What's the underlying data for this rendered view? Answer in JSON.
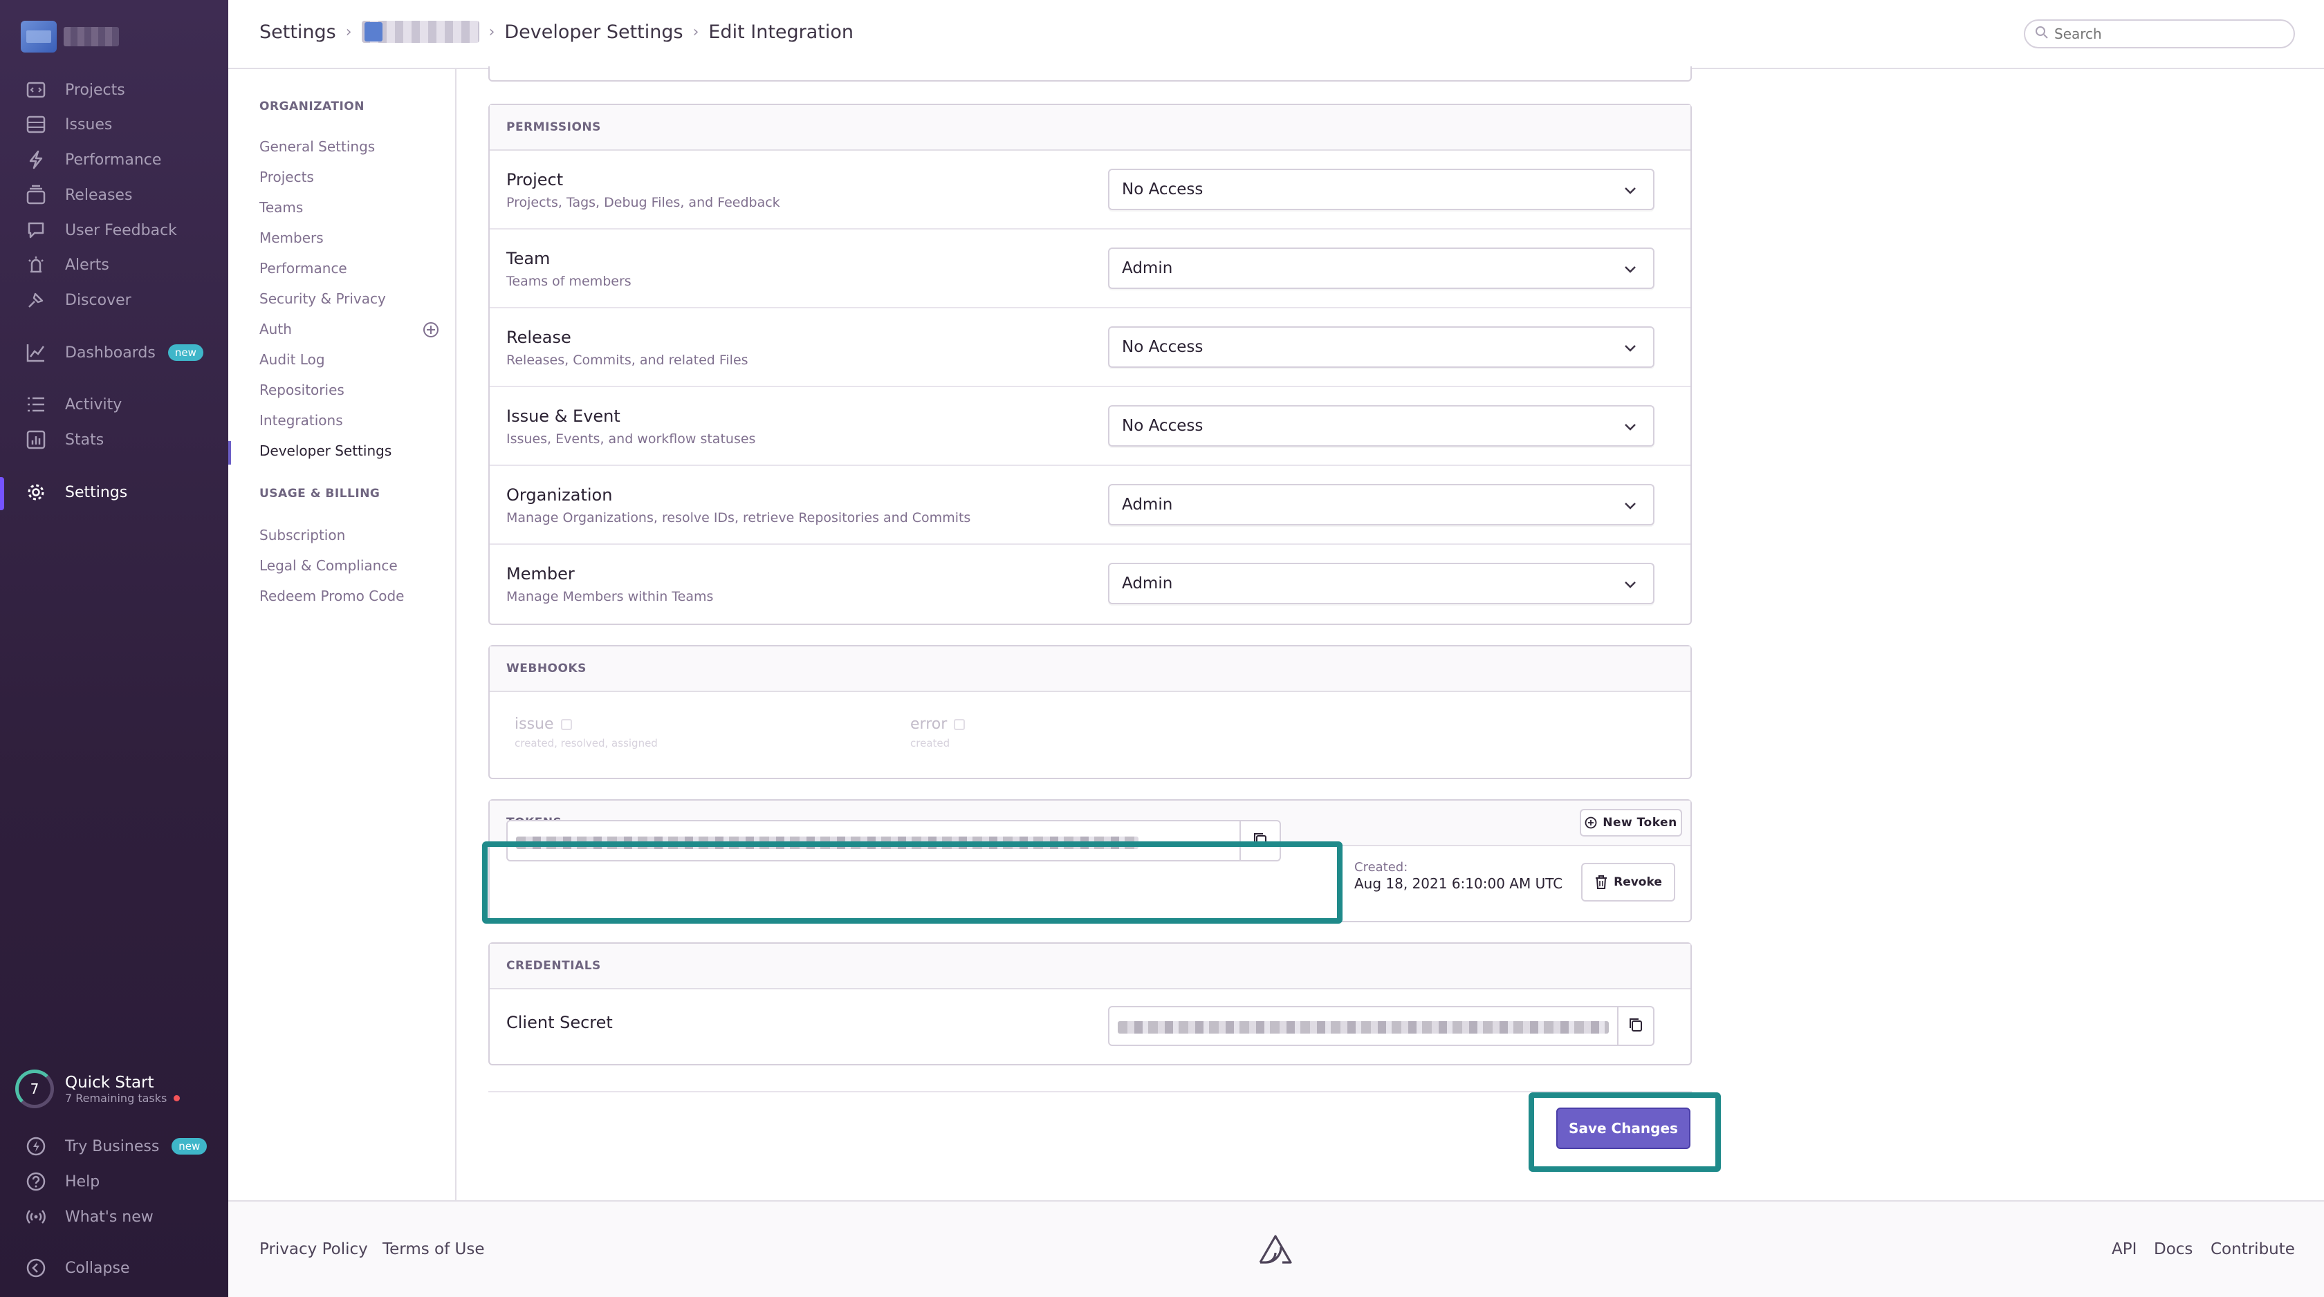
{
  "sidebar": {
    "items": [
      {
        "label": "Projects",
        "icon": "projects-icon"
      },
      {
        "label": "Issues",
        "icon": "issues-icon"
      },
      {
        "label": "Performance",
        "icon": "performance-icon"
      },
      {
        "label": "Releases",
        "icon": "releases-icon"
      },
      {
        "label": "User Feedback",
        "icon": "user-feedback-icon"
      },
      {
        "label": "Alerts",
        "icon": "alerts-icon"
      },
      {
        "label": "Discover",
        "icon": "discover-icon"
      },
      {
        "label": "Dashboards",
        "icon": "dashboards-icon",
        "badge": "new"
      },
      {
        "label": "Activity",
        "icon": "activity-icon"
      },
      {
        "label": "Stats",
        "icon": "stats-icon"
      },
      {
        "label": "Settings",
        "icon": "settings-icon",
        "active": true
      }
    ],
    "quick_start": {
      "count": "7",
      "title": "Quick Start",
      "subtitle": "7 Remaining tasks"
    },
    "bottom": [
      {
        "label": "Try Business",
        "icon": "lightning-icon",
        "badge": "new"
      },
      {
        "label": "Help",
        "icon": "help-icon"
      },
      {
        "label": "What's new",
        "icon": "broadcast-icon"
      },
      {
        "label": "Collapse",
        "icon": "collapse-icon"
      }
    ]
  },
  "header": {
    "breadcrumb": [
      "Settings",
      "Developer Settings",
      "Edit Integration"
    ],
    "search_placeholder": "Search"
  },
  "subnav": {
    "organization_heading": "ORGANIZATION",
    "organization_links": [
      "General Settings",
      "Projects",
      "Teams",
      "Members",
      "Performance",
      "Security & Privacy",
      "Auth",
      "Audit Log",
      "Repositories",
      "Integrations",
      "Developer Settings"
    ],
    "billing_heading": "USAGE & BILLING",
    "billing_links": [
      "Subscription",
      "Legal & Compliance",
      "Redeem Promo Code"
    ]
  },
  "permissions": {
    "heading": "PERMISSIONS",
    "rows": [
      {
        "title": "Project",
        "desc": "Projects, Tags, Debug Files, and Feedback",
        "value": "No Access"
      },
      {
        "title": "Team",
        "desc": "Teams of members",
        "value": "Admin"
      },
      {
        "title": "Release",
        "desc": "Releases, Commits, and related Files",
        "value": "No Access"
      },
      {
        "title": "Issue & Event",
        "desc": "Issues, Events, and workflow statuses",
        "value": "No Access"
      },
      {
        "title": "Organization",
        "desc": "Manage Organizations, resolve IDs, retrieve Repositories and Commits",
        "value": "Admin"
      },
      {
        "title": "Member",
        "desc": "Manage Members within Teams",
        "value": "Admin"
      }
    ]
  },
  "webhooks": {
    "heading": "WEBHOOKS",
    "items": [
      {
        "label": "issue",
        "sub": "created, resolved, assigned"
      },
      {
        "label": "error",
        "sub": "created"
      }
    ]
  },
  "tokens": {
    "heading": "TOKENS",
    "new_token_label": "New Token",
    "created_label": "Created:",
    "created_value": "Aug 18, 2021 6:10:00 AM UTC",
    "revoke_label": "Revoke"
  },
  "credentials": {
    "heading": "CREDENTIALS",
    "client_secret_label": "Client Secret"
  },
  "save_label": "Save Changes",
  "footer": {
    "left": [
      "Privacy Policy",
      "Terms of Use"
    ],
    "right": [
      "API",
      "Docs",
      "Contribute"
    ]
  },
  "colors": {
    "accent": "#6c5fc7",
    "highlight": "#1f8a8a",
    "sidebar": "#2f1f3c"
  }
}
